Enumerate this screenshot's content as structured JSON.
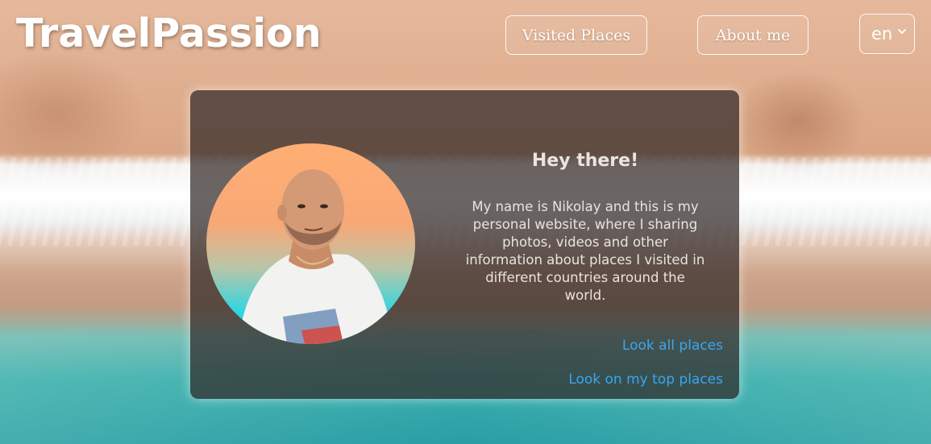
{
  "header": {
    "logo": "TravelPassion",
    "nav": {
      "visited_label": "Visited Places",
      "about_label": "About me"
    },
    "language": {
      "selected": "en"
    }
  },
  "card": {
    "title": "Hey there!",
    "text": "My name is Nikolay and this is my personal website, where I sharing photos, videos and other information about places I visited in different countries around the world.",
    "link_all": "Look all places",
    "link_top": "Look on my top places"
  },
  "colors": {
    "link": "#3aa6f0",
    "card_bg": "rgba(50,42,40,0.72)",
    "avatar_top": "#ffae73",
    "avatar_bottom": "#1ad3e6"
  },
  "icons": {
    "language_dropdown": "chevron-down-icon"
  }
}
